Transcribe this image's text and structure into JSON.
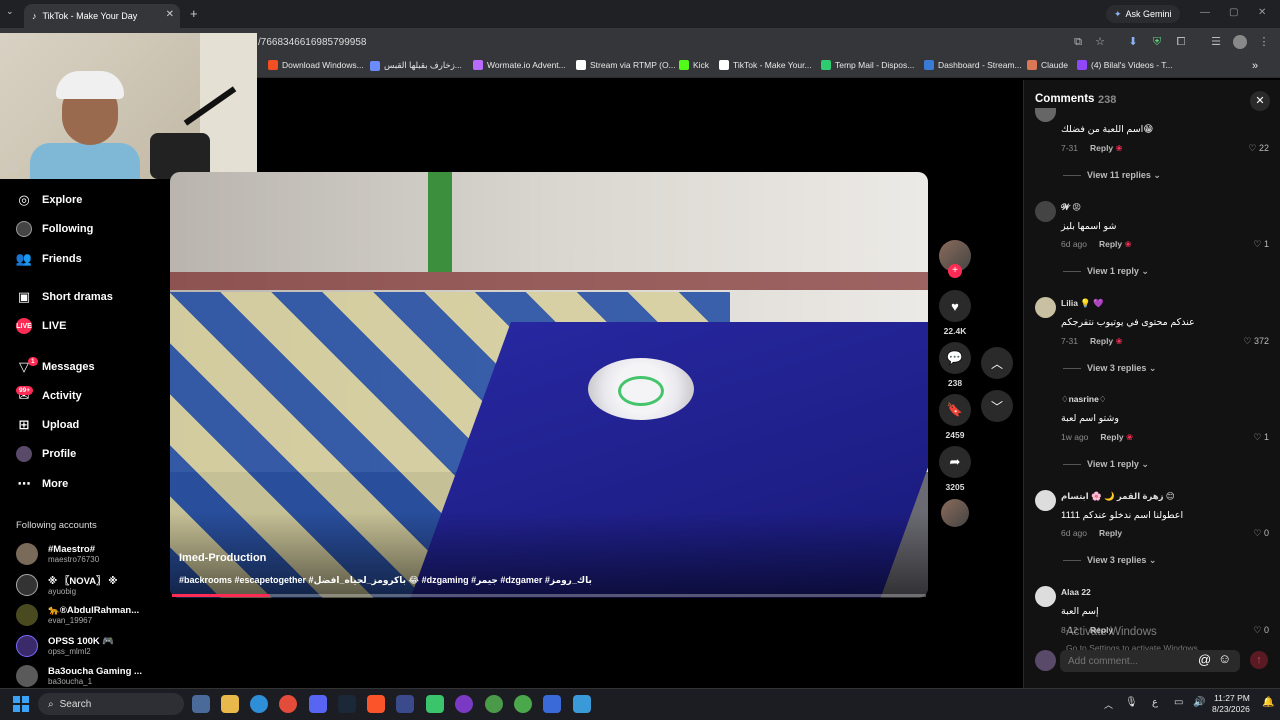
{
  "browser": {
    "tab_title": "TikTok - Make Your Day",
    "url": "/7668346616985799958",
    "ask_gemini": "Ask Gemini",
    "bookmarks": [
      {
        "label": "Download Windows...",
        "color": "#f25022"
      },
      {
        "label": "زخارف بقبلها القبس...",
        "color": "#6a8cff"
      },
      {
        "label": "Wormate.io Advent...",
        "color": "#b86cff"
      },
      {
        "label": "Stream via RTMP (O...",
        "color": "#ffffff"
      },
      {
        "label": "Kick",
        "color": "#53fc18"
      },
      {
        "label": "TikTok - Make Your...",
        "color": "#ffffff"
      },
      {
        "label": "Temp Mail - Dispos...",
        "color": "#2ecc71"
      },
      {
        "label": "Dashboard - Stream...",
        "color": "#3a7bd5"
      },
      {
        "label": "Claude",
        "color": "#d97757"
      },
      {
        "label": "(4) Bilal's Videos - T...",
        "color": "#9146ff"
      }
    ]
  },
  "webcam": {
    "label": "ap|"
  },
  "sidebar": {
    "items": [
      {
        "label": "Explore",
        "icon": "compass-icon"
      },
      {
        "label": "Following",
        "icon": "following-icon"
      },
      {
        "label": "Friends",
        "icon": "friends-icon"
      },
      {
        "label": "Short dramas",
        "icon": "drama-icon"
      },
      {
        "label": "LIVE",
        "icon": "live-icon"
      },
      {
        "label": "Messages",
        "icon": "messages-icon",
        "badge": "1"
      },
      {
        "label": "Activity",
        "icon": "activity-icon",
        "badge": "99+"
      },
      {
        "label": "Upload",
        "icon": "upload-icon"
      },
      {
        "label": "Profile",
        "icon": "profile-icon"
      },
      {
        "label": "More",
        "icon": "more-icon"
      }
    ],
    "following_title": "Following accounts",
    "following": [
      {
        "name": "#Maestro#",
        "user": "maestro76730"
      },
      {
        "name": "※ 〖NOVA〗 ※",
        "user": "ayuobig"
      },
      {
        "name": "🐆®AbdulRahman...",
        "user": "evan_19967"
      },
      {
        "name": "OPSS 100K 🎮",
        "user": "opss_mlml2"
      },
      {
        "name": "Ba3oucha Gaming ...",
        "user": "ba3oucha_1"
      }
    ]
  },
  "video": {
    "author": "Imed-Production",
    "description": "#backrooms #escapetogether #باكرومز_لحياه_افضل 😂 #dzgaming #جيمر #dzgamer #باك_رومز",
    "progress": 0.13
  },
  "actions": {
    "likes": "22.4K",
    "comments": "238",
    "saves": "2459",
    "shares": "3205"
  },
  "comments": {
    "title": "Comments",
    "count": "238",
    "items": [
      {
        "user": "",
        "text": "اسم اللعبة من فضلك😁",
        "date": "7-31",
        "likes": "22",
        "view": "View 11 replies"
      },
      {
        "user": "𝓦 😡",
        "text": "شو اسمها بليز",
        "date": "6d ago",
        "likes": "1",
        "view": "View 1 reply"
      },
      {
        "user": "Lilia 💡 💜",
        "text": "عندكم محتوى في يوتيوب نتفرجكم",
        "date": "7-31",
        "likes": "372",
        "view": "View 3 replies"
      },
      {
        "user": "♢nasrine♢",
        "text": "وشتو اسم لعبة",
        "date": "1w ago",
        "likes": "1",
        "view": "View 1 reply"
      },
      {
        "user": "زهرة القمر 🌙 🌸 ابتسام 😊",
        "text": "اعطولنا اسم ندخلو عندكم 1111",
        "date": "6d ago",
        "likes": "0",
        "view": "View 3 replies"
      },
      {
        "user": "Alaa 22",
        "text": "إسم العبة",
        "date": "8-12",
        "likes": "0",
        "view": ""
      }
    ],
    "reply_label": "Reply",
    "input_placeholder": "Add comment...",
    "activate_title": "Activate Windows",
    "activate_sub": "Go to Settings to activate Windows."
  },
  "taskbar": {
    "search": "Search",
    "time": "11:27 PM",
    "date": "8/23/2026",
    "lang": "ع"
  }
}
